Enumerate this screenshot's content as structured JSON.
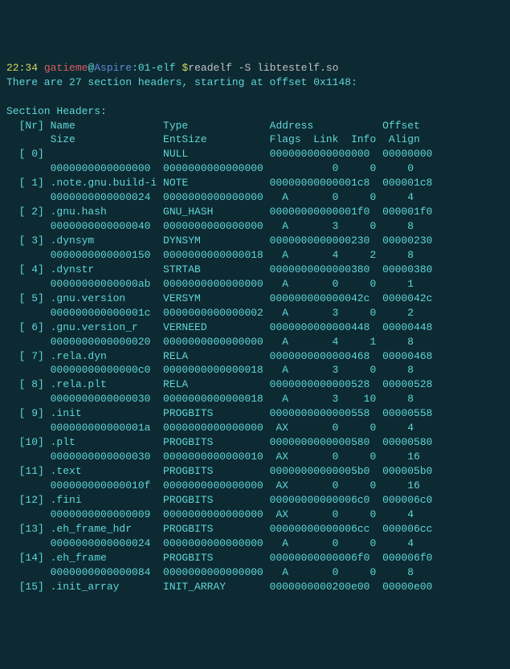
{
  "prompt": {
    "time": "22:34",
    "user": "gatieme",
    "at": "@",
    "host": "Aspire",
    "sep": ":",
    "path": "01-elf",
    "dollar": " $",
    "cmd": "readelf -S libtestelf.so"
  },
  "summary": "There are 27 section headers, starting at offset 0x1148:",
  "blank": "",
  "title": "Section Headers:",
  "hdr1": "  [Nr] Name              Type             Address           Offset",
  "hdr2": "       Size              EntSize          Flags  Link  Info  Align",
  "rows": [
    {
      "l1": "  [ 0]                   NULL             0000000000000000  00000000",
      "l2": "       0000000000000000  0000000000000000           0     0     0"
    },
    {
      "l1": "  [ 1] .note.gnu.build-i NOTE             00000000000001c8  000001c8",
      "l2": "       0000000000000024  0000000000000000   A       0     0     4"
    },
    {
      "l1": "  [ 2] .gnu.hash         GNU_HASH         00000000000001f0  000001f0",
      "l2": "       0000000000000040  0000000000000000   A       3     0     8"
    },
    {
      "l1": "  [ 3] .dynsym           DYNSYM           0000000000000230  00000230",
      "l2": "       0000000000000150  0000000000000018   A       4     2     8"
    },
    {
      "l1": "  [ 4] .dynstr           STRTAB           0000000000000380  00000380",
      "l2": "       00000000000000ab  0000000000000000   A       0     0     1"
    },
    {
      "l1": "  [ 5] .gnu.version      VERSYM           000000000000042c  0000042c",
      "l2": "       000000000000001c  0000000000000002   A       3     0     2"
    },
    {
      "l1": "  [ 6] .gnu.version_r    VERNEED          0000000000000448  00000448",
      "l2": "       0000000000000020  0000000000000000   A       4     1     8"
    },
    {
      "l1": "  [ 7] .rela.dyn         RELA             0000000000000468  00000468",
      "l2": "       00000000000000c0  0000000000000018   A       3     0     8"
    },
    {
      "l1": "  [ 8] .rela.plt         RELA             0000000000000528  00000528",
      "l2": "       0000000000000030  0000000000000018   A       3    10     8"
    },
    {
      "l1": "  [ 9] .init             PROGBITS         0000000000000558  00000558",
      "l2": "       000000000000001a  0000000000000000  AX       0     0     4"
    },
    {
      "l1": "  [10] .plt              PROGBITS         0000000000000580  00000580",
      "l2": "       0000000000000030  0000000000000010  AX       0     0     16"
    },
    {
      "l1": "  [11] .text             PROGBITS         00000000000005b0  000005b0",
      "l2": "       000000000000010f  0000000000000000  AX       0     0     16"
    },
    {
      "l1": "  [12] .fini             PROGBITS         00000000000006c0  000006c0",
      "l2": "       0000000000000009  0000000000000000  AX       0     0     4"
    },
    {
      "l1": "  [13] .eh_frame_hdr     PROGBITS         00000000000006cc  000006cc",
      "l2": "       0000000000000024  0000000000000000   A       0     0     4"
    },
    {
      "l1": "  [14] .eh_frame         PROGBITS         00000000000006f0  000006f0",
      "l2": "       0000000000000084  0000000000000000   A       0     0     8"
    },
    {
      "l1": "  [15] .init_array       INIT_ARRAY       0000000000200e00  00000e00",
      "l2": ""
    }
  ]
}
